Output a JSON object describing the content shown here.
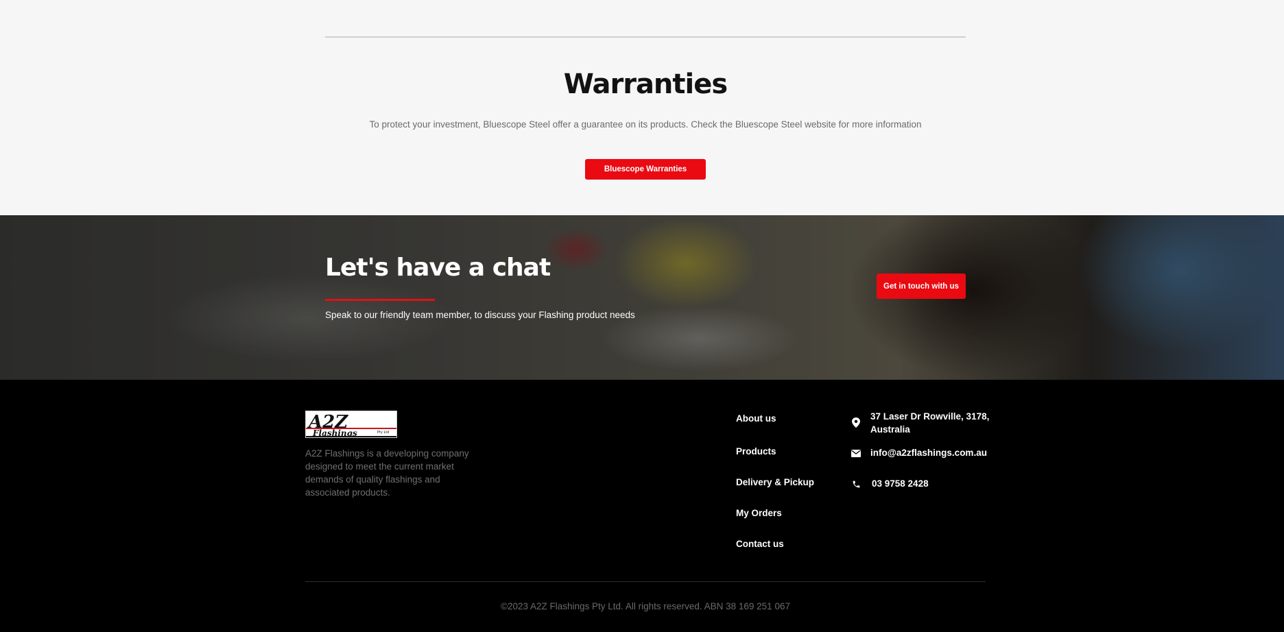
{
  "warranties": {
    "title": "Warranties",
    "description": "To protect your investment, Bluescope Steel offer a guarantee on its products. Check the Bluescope Steel website for more information",
    "button_label": "Bluescope Warranties"
  },
  "chat": {
    "title": "Let's have a chat",
    "subtitle": "Speak to our friendly team member, to discuss your Flashing product needs",
    "button_label": "Get in touch with us"
  },
  "footer": {
    "logo": {
      "main": "A2Z",
      "sub": "Flashings",
      "tag": "Pty Ltd"
    },
    "about": "A2Z Flashings is a developing company designed to meet the current market demands of quality flashings and associated products.",
    "links": [
      "About us",
      "Products",
      "Delivery & Pickup",
      "My Orders",
      "Contact us"
    ],
    "contact": {
      "address": "37 Laser Dr Rowville, 3178, Australia",
      "address_line1": "37 Laser Dr Rowville, 3178,",
      "address_line2": "Australia",
      "email": "info@a2zflashings.com.au",
      "phone": "03 9758 2428"
    },
    "copyright": "©2023 A2Z Flashings Pty Ltd. All rights reserved. ABN 38 169 251 067"
  },
  "colors": {
    "accent": "#ea0a12",
    "footer_bg": "#000000",
    "section_bg": "#f6f6f6"
  }
}
